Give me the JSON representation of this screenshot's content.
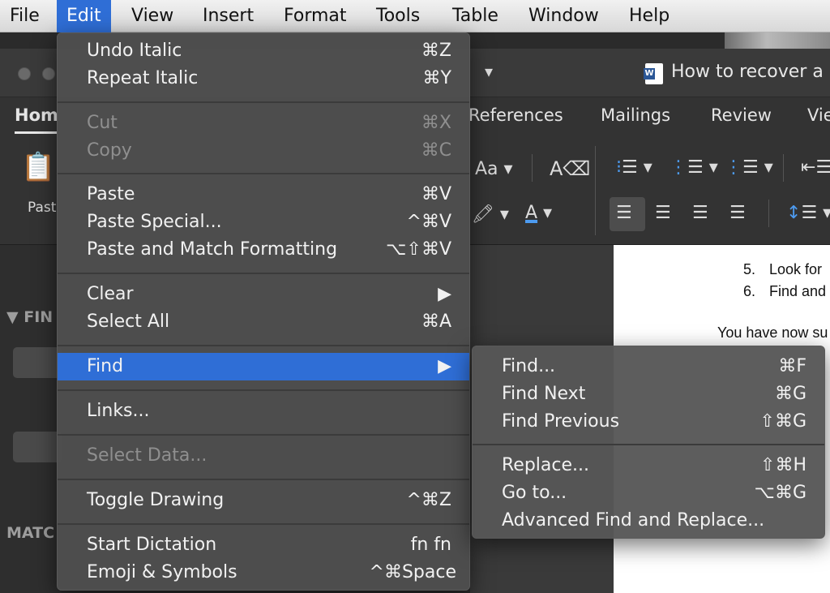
{
  "menubar": {
    "items": [
      "File",
      "Edit",
      "View",
      "Insert",
      "Format",
      "Tools",
      "Table",
      "Window",
      "Help"
    ],
    "active_item": "Edit"
  },
  "window": {
    "title": "How to recover a l",
    "ribbon_tabs": [
      "Hom",
      "References",
      "Mailings",
      "Review",
      "Vie"
    ]
  },
  "ribbon": {
    "paste_label": "Past",
    "font_case_label": "Aa"
  },
  "left_pane": {
    "find_section": "FIN",
    "match_section": "MATC"
  },
  "edit_menu": {
    "items": [
      {
        "label": "Undo Italic",
        "shortcut": "⌘Z",
        "enabled": true
      },
      {
        "label": "Repeat Italic",
        "shortcut": "⌘Y",
        "enabled": true
      },
      {
        "label": "Cut",
        "shortcut": "⌘X",
        "enabled": false
      },
      {
        "label": "Copy",
        "shortcut": "⌘C",
        "enabled": false
      },
      {
        "label": "Paste",
        "shortcut": "⌘V",
        "enabled": true
      },
      {
        "label": "Paste Special...",
        "shortcut": "^⌘V",
        "enabled": true
      },
      {
        "label": "Paste and Match Formatting",
        "shortcut": "⌥⇧⌘V",
        "enabled": true
      },
      {
        "label": "Clear",
        "shortcut": "▶",
        "enabled": true
      },
      {
        "label": "Select All",
        "shortcut": "⌘A",
        "enabled": true
      },
      {
        "label": "Find",
        "shortcut": "▶",
        "enabled": true,
        "selected": true
      },
      {
        "label": "Links...",
        "shortcut": "",
        "enabled": true
      },
      {
        "label": "Select Data...",
        "shortcut": "",
        "enabled": false
      },
      {
        "label": "Toggle Drawing",
        "shortcut": "^⌘Z",
        "enabled": true
      },
      {
        "label": "Start Dictation",
        "shortcut": "fn fn",
        "enabled": true
      },
      {
        "label": "Emoji & Symbols",
        "shortcut": "^⌘Space",
        "enabled": true
      }
    ]
  },
  "find_submenu": {
    "items": [
      {
        "label": "Find...",
        "shortcut": "⌘F"
      },
      {
        "label": "Find Next",
        "shortcut": "⌘G"
      },
      {
        "label": "Find Previous",
        "shortcut": "⇧⌘G"
      },
      {
        "label": "Replace...",
        "shortcut": "⇧⌘H"
      },
      {
        "label": "Go to...",
        "shortcut": "⌥⌘G"
      },
      {
        "label": "Advanced Find and Replace...",
        "shortcut": ""
      }
    ]
  },
  "document": {
    "lines": [
      "5.",
      "Look for",
      "6.",
      "Find and",
      "You have now su"
    ]
  },
  "colors": {
    "menu_highlight": "#2f6ed6",
    "menu_background": "#4e4e4e"
  }
}
